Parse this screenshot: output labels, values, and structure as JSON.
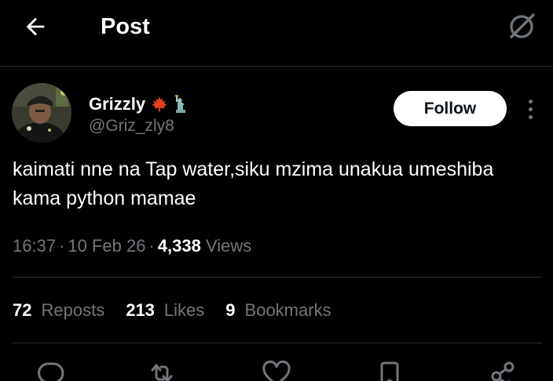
{
  "header": {
    "title": "Post",
    "back_icon": "arrow-left-icon",
    "grok_icon": "grok-slash-icon"
  },
  "author": {
    "display_name": "Grizzly",
    "name_emojis": [
      "maple-leaf-icon",
      "statue-of-liberty-icon"
    ],
    "handle": "@Griz_zly8",
    "follow_label": "Follow"
  },
  "tweet": {
    "text": "kaimati nne na Tap water,siku mzima unakua umeshiba kama python mamae"
  },
  "meta": {
    "time": "16:37",
    "date": "10 Feb 26",
    "views_count": "4,338",
    "views_label": "Views",
    "separator": "·"
  },
  "stats": {
    "reposts_count": "72",
    "reposts_label": "Reposts",
    "likes_count": "213",
    "likes_label": "Likes",
    "bookmarks_count": "9",
    "bookmarks_label": "Bookmarks"
  },
  "actions": [
    "reply-icon",
    "repost-icon",
    "like-icon",
    "bookmark-icon",
    "share-icon"
  ],
  "colors": {
    "background": "#000000",
    "text_primary": "#ffffff",
    "text_secondary": "#71767b",
    "divider": "#2f3336",
    "follow_bg": "#ffffff"
  }
}
